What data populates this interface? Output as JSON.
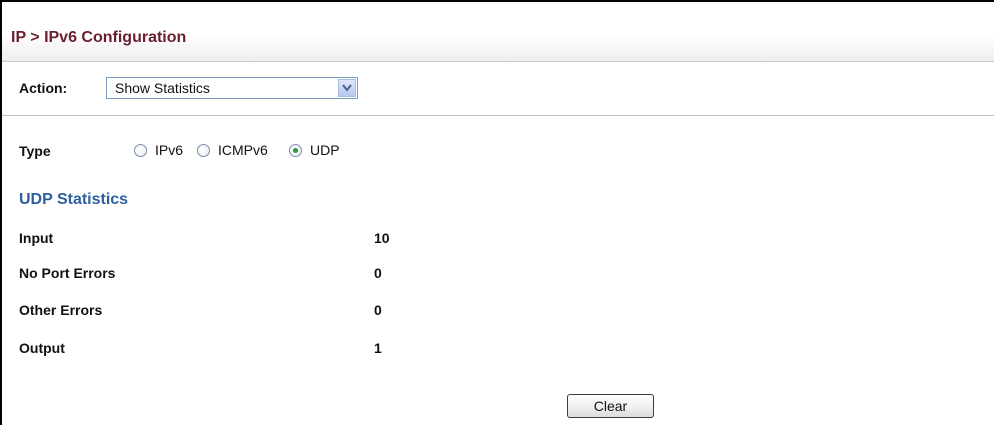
{
  "header": {
    "title": "IP > IPv6 Configuration"
  },
  "action": {
    "label": "Action:",
    "selected": "Show Statistics"
  },
  "type": {
    "label": "Type",
    "options": [
      {
        "label": "IPv6",
        "checked": false
      },
      {
        "label": "ICMPv6",
        "checked": false
      },
      {
        "label": "UDP",
        "checked": true
      }
    ]
  },
  "stats": {
    "heading": "UDP Statistics",
    "rows": [
      {
        "label": "Input",
        "value": "10"
      },
      {
        "label": "No Port Errors",
        "value": "0"
      },
      {
        "label": "Other Errors",
        "value": "0"
      },
      {
        "label": "Output",
        "value": "1"
      }
    ]
  },
  "buttons": {
    "clear": "Clear"
  },
  "colors": {
    "title": "#6b1f2e",
    "heading": "#2e5f9e",
    "radio_checked": "#2a9a3a"
  }
}
